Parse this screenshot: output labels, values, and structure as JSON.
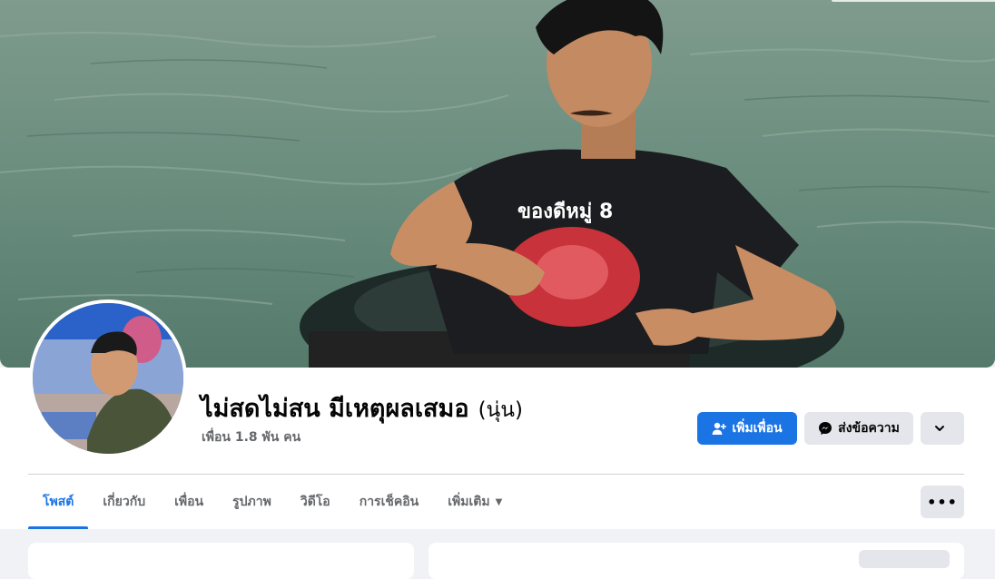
{
  "profile": {
    "name": "ไม่สดไม่สน มีเหตุผลเสมอ",
    "nickname": "(นุ่น)",
    "friends_count": "เพื่อน 1.8 พัน คน"
  },
  "actions": {
    "add_friend": "เพิ่มเพื่อน",
    "message": "ส่งข้อความ"
  },
  "tabs": [
    {
      "label": "โพสต์",
      "active": true
    },
    {
      "label": "เกี่ยวกับ",
      "active": false
    },
    {
      "label": "เพื่อน",
      "active": false
    },
    {
      "label": "รูปภาพ",
      "active": false
    },
    {
      "label": "วิดีโอ",
      "active": false
    },
    {
      "label": "การเช็คอิน",
      "active": false
    },
    {
      "label": "เพิ่มเติม",
      "active": false
    }
  ],
  "cover_shirt_text": "ของดีหมู่ 8",
  "colors": {
    "accent": "#1b74e4",
    "secondary_button": "#e4e6eb",
    "muted_text": "#65676b",
    "page_bg": "#f0f2f5"
  },
  "icons": [
    "add-friend-icon",
    "messenger-icon",
    "chevron-down-icon",
    "more-dots-icon",
    "caret-down-icon"
  ]
}
